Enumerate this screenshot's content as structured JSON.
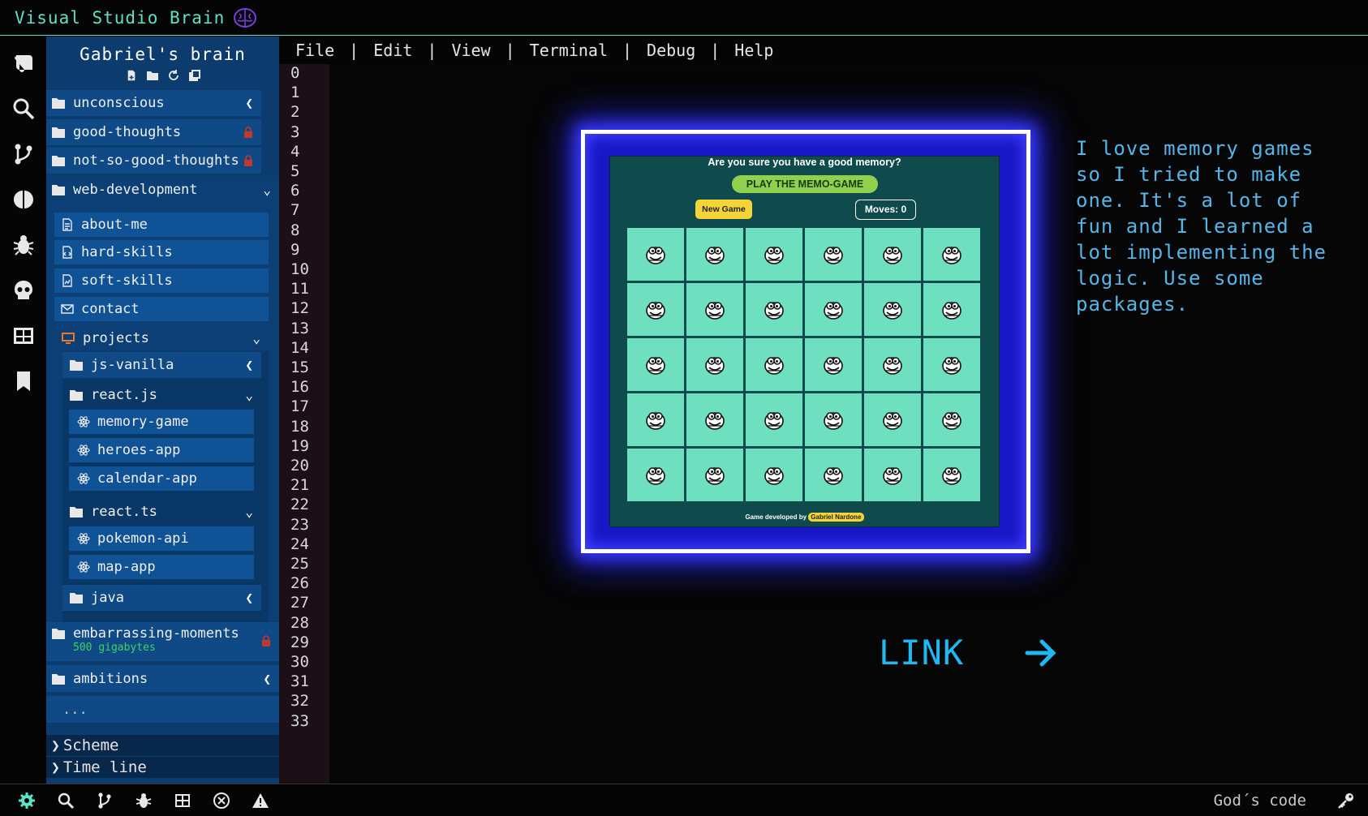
{
  "title_bar": {
    "app_title": "Visual Studio Brain",
    "logo": "brain-icon"
  },
  "activity_bar": [
    "explorer-icon",
    "search-icon",
    "source-control-icon",
    "brain-icon",
    "bug-icon",
    "skull-icon",
    "grid-icon",
    "bookmark-icon"
  ],
  "sidebar": {
    "header": "Gabriel's brain",
    "tools": [
      "new-file-icon",
      "new-folder-icon",
      "refresh-icon",
      "collapse-icon"
    ],
    "top_folders": [
      {
        "label": "unconscious",
        "state": "collapsed"
      },
      {
        "label": "good-thoughts",
        "state": "locked"
      },
      {
        "label": "not-so-good-thoughts",
        "state": "locked"
      },
      {
        "label": "web-development",
        "state": "expanded"
      }
    ],
    "web_files": [
      {
        "label": "about-me",
        "icon": "file-icon"
      },
      {
        "label": "hard-skills",
        "icon": "file-code-icon"
      },
      {
        "label": "soft-skills",
        "icon": "file-chart-icon"
      },
      {
        "label": "contact",
        "icon": "envelope-icon"
      }
    ],
    "projects": {
      "label": "projects"
    },
    "js_vanilla": {
      "label": "js-vanilla"
    },
    "react_js": {
      "label": "react.js",
      "items": [
        "memory-game",
        "heroes-app",
        "calendar-app"
      ]
    },
    "react_ts": {
      "label": "react.ts",
      "items": [
        "pokemon-api",
        "map-app"
      ]
    },
    "java": {
      "label": "java"
    },
    "embarrassing": {
      "label": "embarrassing-moments",
      "sub": "500 gigabytes"
    },
    "ambitions": {
      "label": "ambitions"
    },
    "more": "...",
    "sections": [
      "Scheme",
      "Time line"
    ]
  },
  "menu": [
    "File",
    "Edit",
    "View",
    "Terminal",
    "Debug",
    "Help"
  ],
  "menu_separator": "|",
  "line_numbers": [
    "0",
    "1",
    "2",
    "3",
    "4",
    "5",
    "6",
    "7",
    "8",
    "9",
    "10",
    "11",
    "12",
    "13",
    "14",
    "15",
    "16",
    "17",
    "18",
    "19",
    "20",
    "21",
    "22",
    "23",
    "24",
    "25",
    "26",
    "27",
    "28",
    "29",
    "30",
    "31",
    "32",
    "33"
  ],
  "game": {
    "question": "Are you sure you have a good memory?",
    "play_label": "PLAY THE MEMO-GAME",
    "new_game": "New Game",
    "moves": "Moves: 0",
    "credit_prefix": "Game developed by",
    "credit_name": "Gabriel Nardone",
    "card_icon": "face-icon",
    "rows": 5,
    "cols": 6,
    "colors": {
      "card": "#6ee0c0",
      "board": "#0f4a4c",
      "play": "#8fd14f",
      "yellow": "#f5d438"
    }
  },
  "description": "I love memory games so I tried to make one. It's a lot of fun and I learned a lot implementing the logic. Use some packages.",
  "link": {
    "label": "LINK",
    "icon": "arrow-right-icon"
  },
  "status_bar": {
    "icons": [
      "gear-icon",
      "search-icon",
      "source-control-icon",
      "bug-icon",
      "grid-icon",
      "close-circle-icon",
      "warning-icon"
    ],
    "right_text": "God´s code",
    "key_icon": "key-icon"
  },
  "colors": {
    "accent": "#5fe0c8",
    "sidebar": "#0c3c6e",
    "neon": "#1818c8",
    "link": "#1fb8f0"
  }
}
